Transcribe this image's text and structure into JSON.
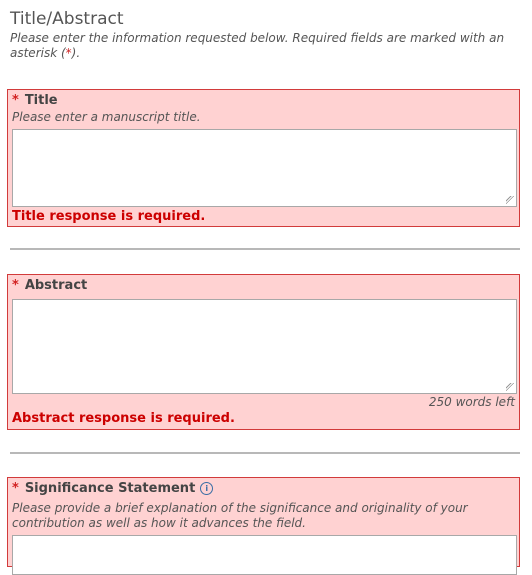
{
  "page": {
    "title": "Title/Abstract",
    "instructions_prefix": "Please enter the information requested below. Required fields are marked with an asterisk (",
    "instructions_star": "*",
    "instructions_suffix": ")."
  },
  "fields": {
    "title": {
      "star": "*",
      "label": "Title",
      "hint": "Please enter a manuscript title.",
      "value": "",
      "error": "Title response is required."
    },
    "abstract": {
      "star": "*",
      "label": "Abstract",
      "value": "",
      "word_count": "250 words left",
      "error": "Abstract response is required."
    },
    "significance": {
      "star": "*",
      "label": "Significance Statement",
      "info_icon": "info-icon",
      "info_glyph": "i",
      "hint": "Please provide a brief explanation of the significance and originality of your contribution as well as how it advances the field.",
      "value": ""
    }
  },
  "colors": {
    "error_background": "#ffd2d2",
    "error_border": "#d23b3b",
    "error_text": "#cc0000",
    "required_star": "#d22222"
  }
}
